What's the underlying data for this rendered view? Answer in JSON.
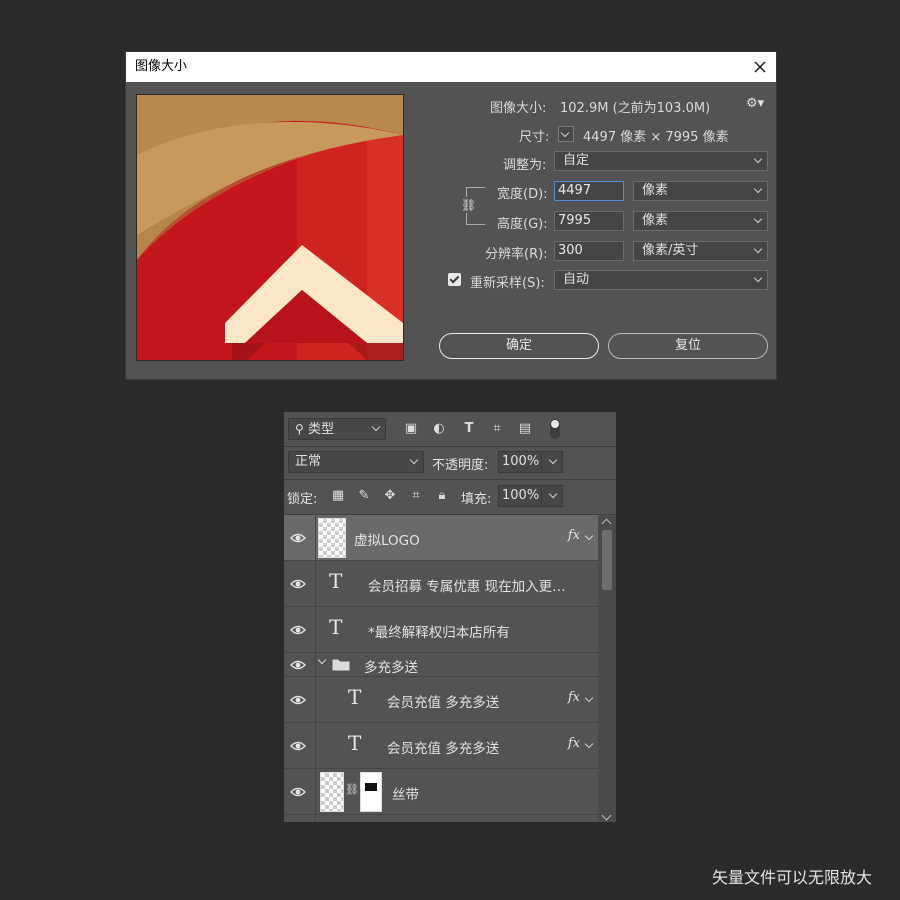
{
  "dialog": {
    "title": "图像大小",
    "image_size_label": "图像大小:",
    "image_size_value": "102.9M (之前为103.0M)",
    "dimensions_label": "尺寸:",
    "dimensions_value": "4497 像素  ×  7995 像素",
    "fit_label": "调整为:",
    "fit_value": "自定",
    "width_label": "宽度(D):",
    "width_value": "4497",
    "width_unit": "像素",
    "height_label": "高度(G):",
    "height_value": "7995",
    "height_unit": "像素",
    "resolution_label": "分辨率(R):",
    "resolution_value": "300",
    "resolution_unit": "像素/英寸",
    "resample_label": "重新采样(S):",
    "resample_checked": true,
    "resample_value": "自动",
    "ok_label": "确定",
    "reset_label": "复位",
    "preview_colors": {
      "red": "#c4161c",
      "gold": "#c89a5a",
      "cream": "#fbe6c8"
    }
  },
  "layers_panel": {
    "filter_label": "类型",
    "blend_mode": "正常",
    "opacity_label": "不透明度:",
    "opacity_value": "100%",
    "lock_label": "锁定:",
    "fill_label": "填充:",
    "fill_value": "100%",
    "layers": [
      {
        "name": "虚拟LOGO",
        "type": "smart",
        "fx": "fx",
        "selected": true
      },
      {
        "name": "会员招募 专属优惠 现在加入更…",
        "type": "text"
      },
      {
        "name": "*最终解释权归本店所有",
        "type": "text"
      },
      {
        "name": "多充多送",
        "type": "group"
      },
      {
        "name": "会员充值 多充多送",
        "type": "text",
        "fx": "fx"
      },
      {
        "name": "会员充值  多充多送",
        "type": "text",
        "fx": "fx"
      },
      {
        "name": "丝带",
        "type": "masked"
      }
    ]
  },
  "caption": "矢量文件可以无限放大"
}
